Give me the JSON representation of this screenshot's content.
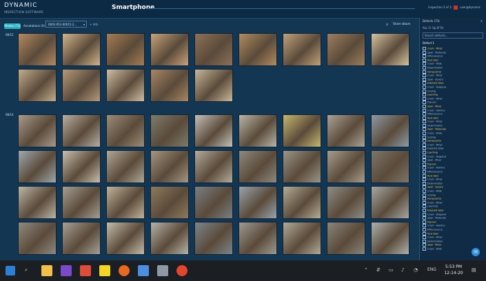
{
  "app": {
    "logo": "DYNAMIC",
    "logo_sub": "INSPECTION SOFTWARE",
    "title": "Smartphone",
    "top_right": "Inspection 2 of 3",
    "user": "user@dynamic",
    "select_value": "0002-053-00015-2...",
    "select_note": "+ Info",
    "filter_active": "Photos (73)",
    "filter_tab": "Annotations (0)",
    "share_label": "Share album"
  },
  "sections": [
    {
      "tag": "08/12",
      "count": 14
    },
    {
      "tag": "08/14",
      "count": 36
    }
  ],
  "thumb_colors": {
    "row1": [
      "#b58a60",
      "#d2b48c",
      "#a67c52",
      "#c9a27a",
      "#8e7158",
      "#b38c5f",
      "#c1a17c",
      "#9c7e5e",
      "#d7c3a0"
    ],
    "row2": [
      "#c3ad8c",
      "#b59a7a",
      "#d1bfa2",
      "#a98763",
      "#c8b89a"
    ],
    "row3": [
      "#a79b8c",
      "#b8b0a2",
      "#9c8d78",
      "#7d7c6d",
      "#c4c1b9",
      "#b9b6a8",
      "#c7b86e",
      "#aaa396",
      "#8e9aa5"
    ],
    "row4": [
      "#a0a8ad",
      "#c9bfae",
      "#b1a897",
      "#a59783",
      "#b4ac9c",
      "#8d8a7e",
      "#9b9688",
      "#a89e8d",
      "#7d766a"
    ],
    "row5": [
      "#bcb5a6",
      "#a59f93",
      "#c1b49b",
      "#8f7a5d",
      "#7a7f84",
      "#9aa3ab",
      "#b6ad95",
      "#8f8e85",
      "#a7a8a3"
    ],
    "row6": [
      "#8f8a80",
      "#a6a096",
      "#c4bca9",
      "#b8b3a8",
      "#7d858a",
      "#9e9a92",
      "#b3aa98",
      "#8a8478",
      "#aeb0ad"
    ]
  },
  "sidebar": {
    "header": "Defects (73)",
    "tabs": "ALL  Cr  Sp  Ef  Rs",
    "search_placeholder": "Search defects...",
    "group": "Defect 1",
    "rows": [
      "Crack - Minor",
      "Spall - Moderate",
      "Efflorescence",
      "Rust stain",
      "Crack - Wide",
      "Delamination",
      "Honeycomb",
      "Crack - Minor",
      "Spall - Severe",
      "Exposed rebar",
      "Crack - Diagonal",
      "Scaling",
      "Leaching",
      "Crack - Minor",
      "Pop-out",
      "Spall - Minor",
      "Crack - Hairline",
      "Efflorescence",
      "Rust stain",
      "Crack - Minor",
      "Delamination",
      "Spall - Moderate",
      "Crack - Wide",
      "Scaling",
      "Honeycomb",
      "Crack - Minor",
      "Exposed rebar",
      "Leaching",
      "Crack - Diagonal",
      "Spall - Minor",
      "Pop-out",
      "Crack - Hairline",
      "Efflorescence",
      "Rust stain",
      "Crack - Minor",
      "Delamination",
      "Spall - Severe",
      "Crack - Wide",
      "Scaling",
      "Honeycomb",
      "Crack - Minor",
      "Leaching",
      "Exposed rebar",
      "Crack - Diagonal",
      "Spall - Moderate",
      "Pop-out",
      "Crack - Hairline",
      "Efflorescence",
      "Rust stain",
      "Crack - Minor",
      "Delamination",
      "Spall - Minor",
      "Crack - Wide"
    ]
  },
  "taskbar": {
    "time": "5:53 PM",
    "date": "12-14-20"
  }
}
